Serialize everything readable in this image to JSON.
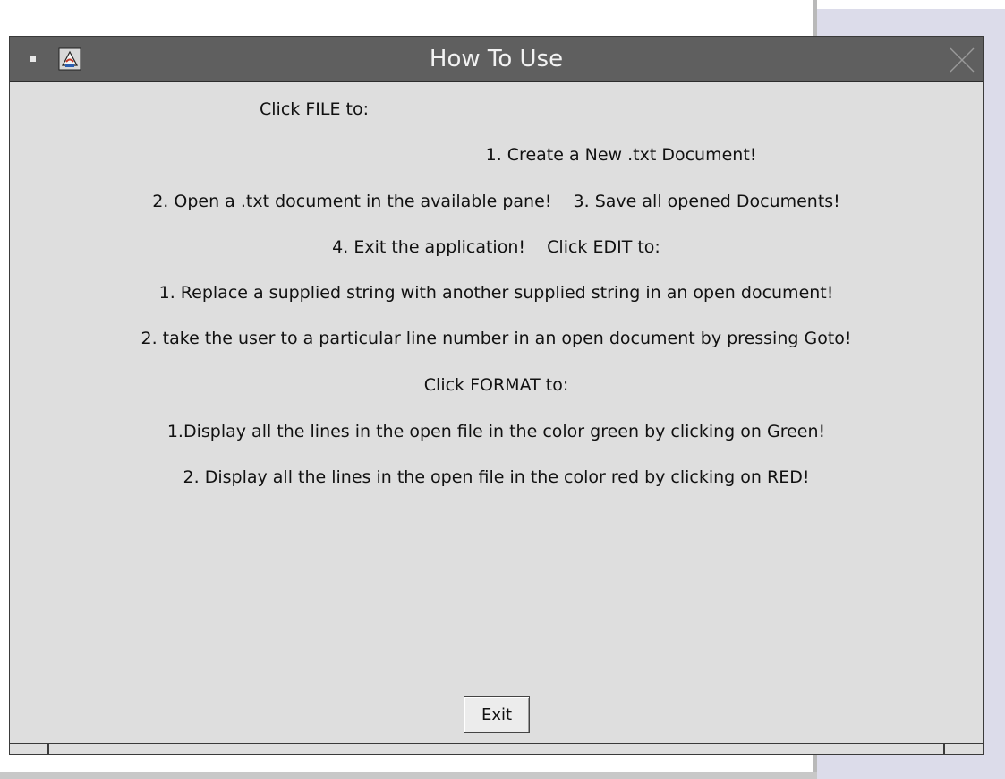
{
  "window": {
    "title": "How To Use"
  },
  "instructions": {
    "file_heading": "Click FILE to:",
    "file_item_1": "1. Create a New .txt Document!",
    "file_items_2_3": "2. Open a .txt document in the available pane!    3. Save all opened Documents!",
    "file_item_4_edit_heading": "4. Exit the application!    Click EDIT to:",
    "edit_item_1": "1. Replace a supplied string with another supplied string in an open document!",
    "edit_item_2": "2. take the user to a particular line number in an open document by pressing Goto!",
    "format_heading": "Click FORMAT to:",
    "format_item_1": "1.Display all the lines in the open file in the color green by clicking on Green!",
    "format_item_2": "2. Display all the lines in the open file in the color red by clicking on RED!"
  },
  "buttons": {
    "exit_label": "Exit"
  },
  "icons": {
    "window_menu": "window-menu-icon",
    "app": "java-app-icon",
    "close": "close-icon"
  },
  "colors": {
    "titlebar": "#5f5f5f",
    "dialog_background": "#dedede",
    "right_panel": "#dcdcea"
  }
}
